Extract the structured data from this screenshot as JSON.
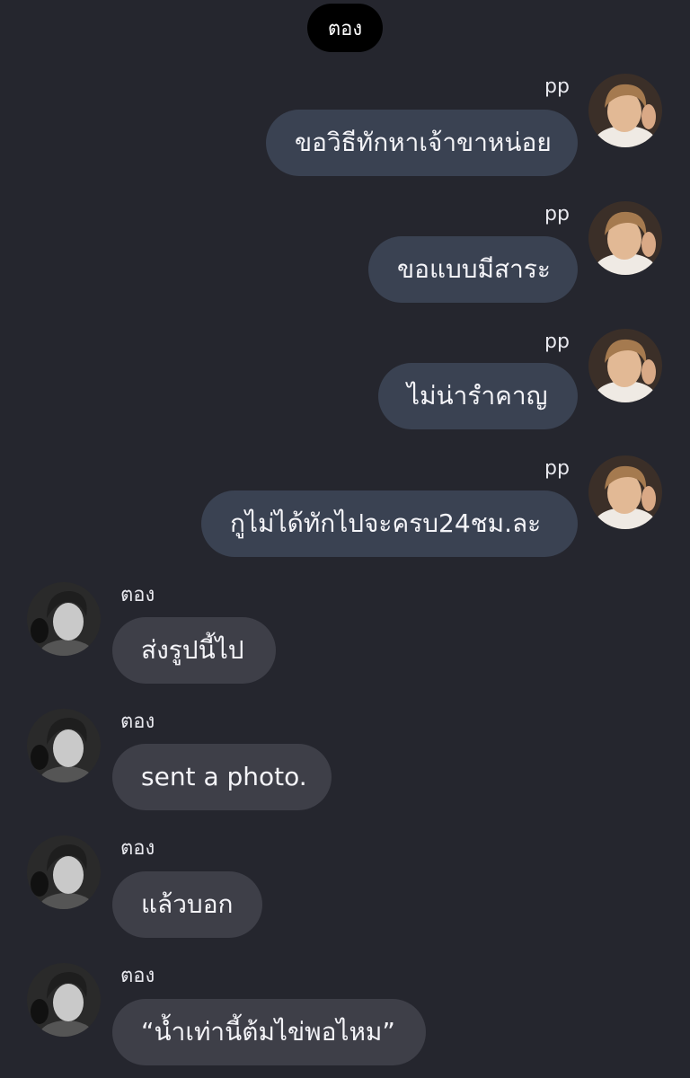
{
  "header": {
    "title": "ตอง"
  },
  "messages": [
    {
      "sender": "pp",
      "text": "ขอวิธีทักหาเจ้าขาหน่อย",
      "direction": "outgoing"
    },
    {
      "sender": "pp",
      "text": "ขอแบบมีสาระ",
      "direction": "outgoing"
    },
    {
      "sender": "pp",
      "text": "ไม่น่ารำคาญ",
      "direction": "outgoing"
    },
    {
      "sender": "pp",
      "text": "กูไม่ได้ทักไปจะครบ24ชม.ละ",
      "direction": "outgoing"
    },
    {
      "sender": "ตอง",
      "text": "ส่งรูปนี้ไป",
      "direction": "incoming"
    },
    {
      "sender": "ตอง",
      "text": "sent a photo.",
      "direction": "incoming"
    },
    {
      "sender": "ตอง",
      "text": "แล้วบอก",
      "direction": "incoming"
    },
    {
      "sender": "ตอง",
      "text": "“น้ำเท่านี้ต้มไข่พอไหม”",
      "direction": "incoming"
    }
  ],
  "colors": {
    "background": "#25262e",
    "outgoing_bubble": "#3a4252",
    "incoming_bubble": "#3e3f48"
  },
  "icons": {
    "outgoing_avatar": "avatar-photo",
    "incoming_avatar": "avatar-photo-grayscale"
  }
}
